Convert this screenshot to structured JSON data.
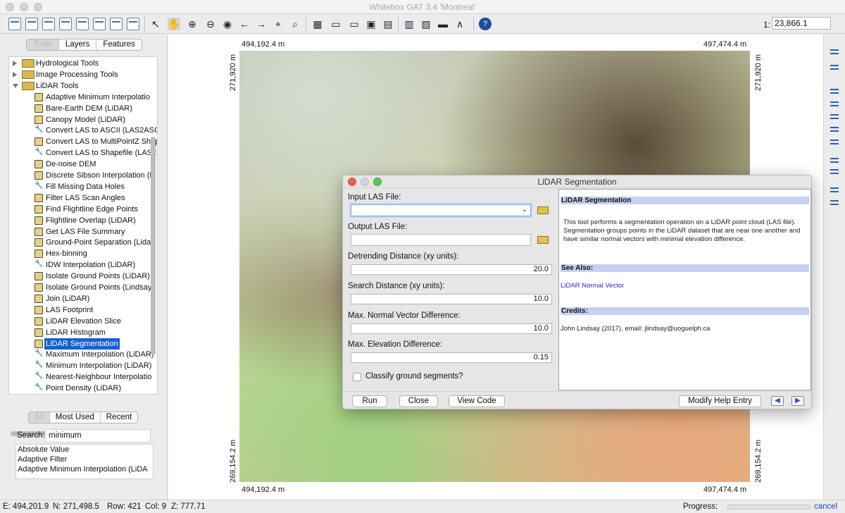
{
  "window": {
    "title": "Whitebox GAT 3.4 'Montreal'"
  },
  "toolbar": {
    "scale_prefix": "1:",
    "scale_value": "23,866.1"
  },
  "left_panel": {
    "tabs": [
      "Tools",
      "Layers",
      "Features"
    ],
    "tree": {
      "groups": [
        {
          "label": "Hydrological Tools",
          "expanded": false
        },
        {
          "label": "Image Processing Tools",
          "expanded": false
        },
        {
          "label": "LiDAR Tools",
          "expanded": true
        }
      ],
      "lidar_items": [
        {
          "label": "Adaptive Minimum Interpolatio",
          "icon": "scroll-icon"
        },
        {
          "label": "Bare-Earth DEM (LiDAR)",
          "icon": "scroll-icon"
        },
        {
          "label": "Canopy Model (LiDAR)",
          "icon": "scroll-icon"
        },
        {
          "label": "Convert LAS to ASCII (LAS2ASCI",
          "icon": "wrench-icon"
        },
        {
          "label": "Convert LAS to MultiPointZ Shap",
          "icon": "scroll-icon"
        },
        {
          "label": "Convert LAS to Shapefile (LAS2S",
          "icon": "wrench-icon"
        },
        {
          "label": "De-noise DEM",
          "icon": "scroll-icon"
        },
        {
          "label": "Discrete Sibson Interpolation (L",
          "icon": "scroll-icon"
        },
        {
          "label": "Fill Missing Data Holes",
          "icon": "wrench-icon"
        },
        {
          "label": "Filter LAS Scan Angles",
          "icon": "scroll-icon"
        },
        {
          "label": "Find Flightline Edge Points",
          "icon": "scroll-icon"
        },
        {
          "label": "Flightline Overlap (LiDAR)",
          "icon": "scroll-icon"
        },
        {
          "label": "Get LAS File Summary",
          "icon": "scroll-icon"
        },
        {
          "label": "Ground-Point Separation (Lidar",
          "icon": "scroll-icon"
        },
        {
          "label": "Hex-binning",
          "icon": "scroll-icon"
        },
        {
          "label": "IDW Interpolation (LiDAR)",
          "icon": "wrench-icon"
        },
        {
          "label": "Isolate Ground Points (LiDAR)",
          "icon": "scroll-icon"
        },
        {
          "label": "Isolate Ground Points (Lindsays",
          "icon": "scroll-icon"
        },
        {
          "label": "Join (LiDAR)",
          "icon": "scroll-icon"
        },
        {
          "label": "LAS Footprint",
          "icon": "scroll-icon"
        },
        {
          "label": "LiDAR Elevation Slice",
          "icon": "scroll-icon"
        },
        {
          "label": "LiDAR Histogram",
          "icon": "scroll-icon"
        },
        {
          "label": "LiDAR Segmentation",
          "icon": "scroll-icon",
          "selected": true
        },
        {
          "label": "Maximum Interpolation (LiDAR)",
          "icon": "wrench-icon"
        },
        {
          "label": "Minimum Interpolation (LiDAR)",
          "icon": "wrench-icon"
        },
        {
          "label": "Nearest-Neighbour Interpolatio",
          "icon": "wrench-icon"
        },
        {
          "label": "Point Density (LiDAR)",
          "icon": "wrench-icon"
        }
      ]
    },
    "lower_tabs": [
      "All",
      "Most Used",
      "Recent"
    ],
    "search": {
      "label": "Search:",
      "value": "minimum"
    },
    "results": [
      "Absolute Value",
      "Adaptive Filter",
      "Adaptive Minimum Interpolation (LiDA"
    ]
  },
  "map": {
    "top_left_x": "494,192.4 m",
    "top_right_x": "497,474.4 m",
    "bottom_left_x": "494,192.4 m",
    "bottom_right_x": "497,474.4 m",
    "left_top_y": "271,920 m",
    "right_top_y": "271,920 m",
    "left_bottom_y": "269,154.2 m",
    "right_bottom_y": "269,154.2 m"
  },
  "dialog": {
    "title": "LiDAR Segmentation",
    "fields": {
      "input_las_label": "Input LAS File:",
      "output_las_label": "Output LAS File:",
      "detrend_label": "Detrending Distance (xy units):",
      "detrend_value": "20.0",
      "search_label": "Search Distance (xy units):",
      "search_value": "10.0",
      "normal_label": "Max. Normal Vector Difference:",
      "normal_value": "10.0",
      "elev_label": "Max. Elevation Difference:",
      "elev_value": "0.15",
      "classify_label": "Classify ground segments?"
    },
    "help": {
      "heading": "LiDAR Segmentation",
      "body": "This tool performs a segmentation operation on a LiDAR point cloud (LAS file). Segmentation groups points in the LiDAR dataset that are near one another and have similar normal vectors with minimal elevation difference.",
      "see_also_heading": "See Also:",
      "see_also_link": "LiDAR Normal Vector",
      "credits_heading": "Credits:",
      "credits_text": "John Lindsay (2017), email: jlindsay@uoguelph.ca"
    },
    "buttons": {
      "run": "Run",
      "close": "Close",
      "view_code": "View Code",
      "modify_help": "Modify Help Entry",
      "prev": "◀",
      "next": "▶"
    }
  },
  "status": {
    "easting": "E: 494,201.9",
    "northing": "N: 271,498.5",
    "row": "Row: 421",
    "col": "Col: 9",
    "z": "Z: 777.71",
    "progress_label": "Progress:",
    "progress_value": 0,
    "cancel": "cancel"
  }
}
